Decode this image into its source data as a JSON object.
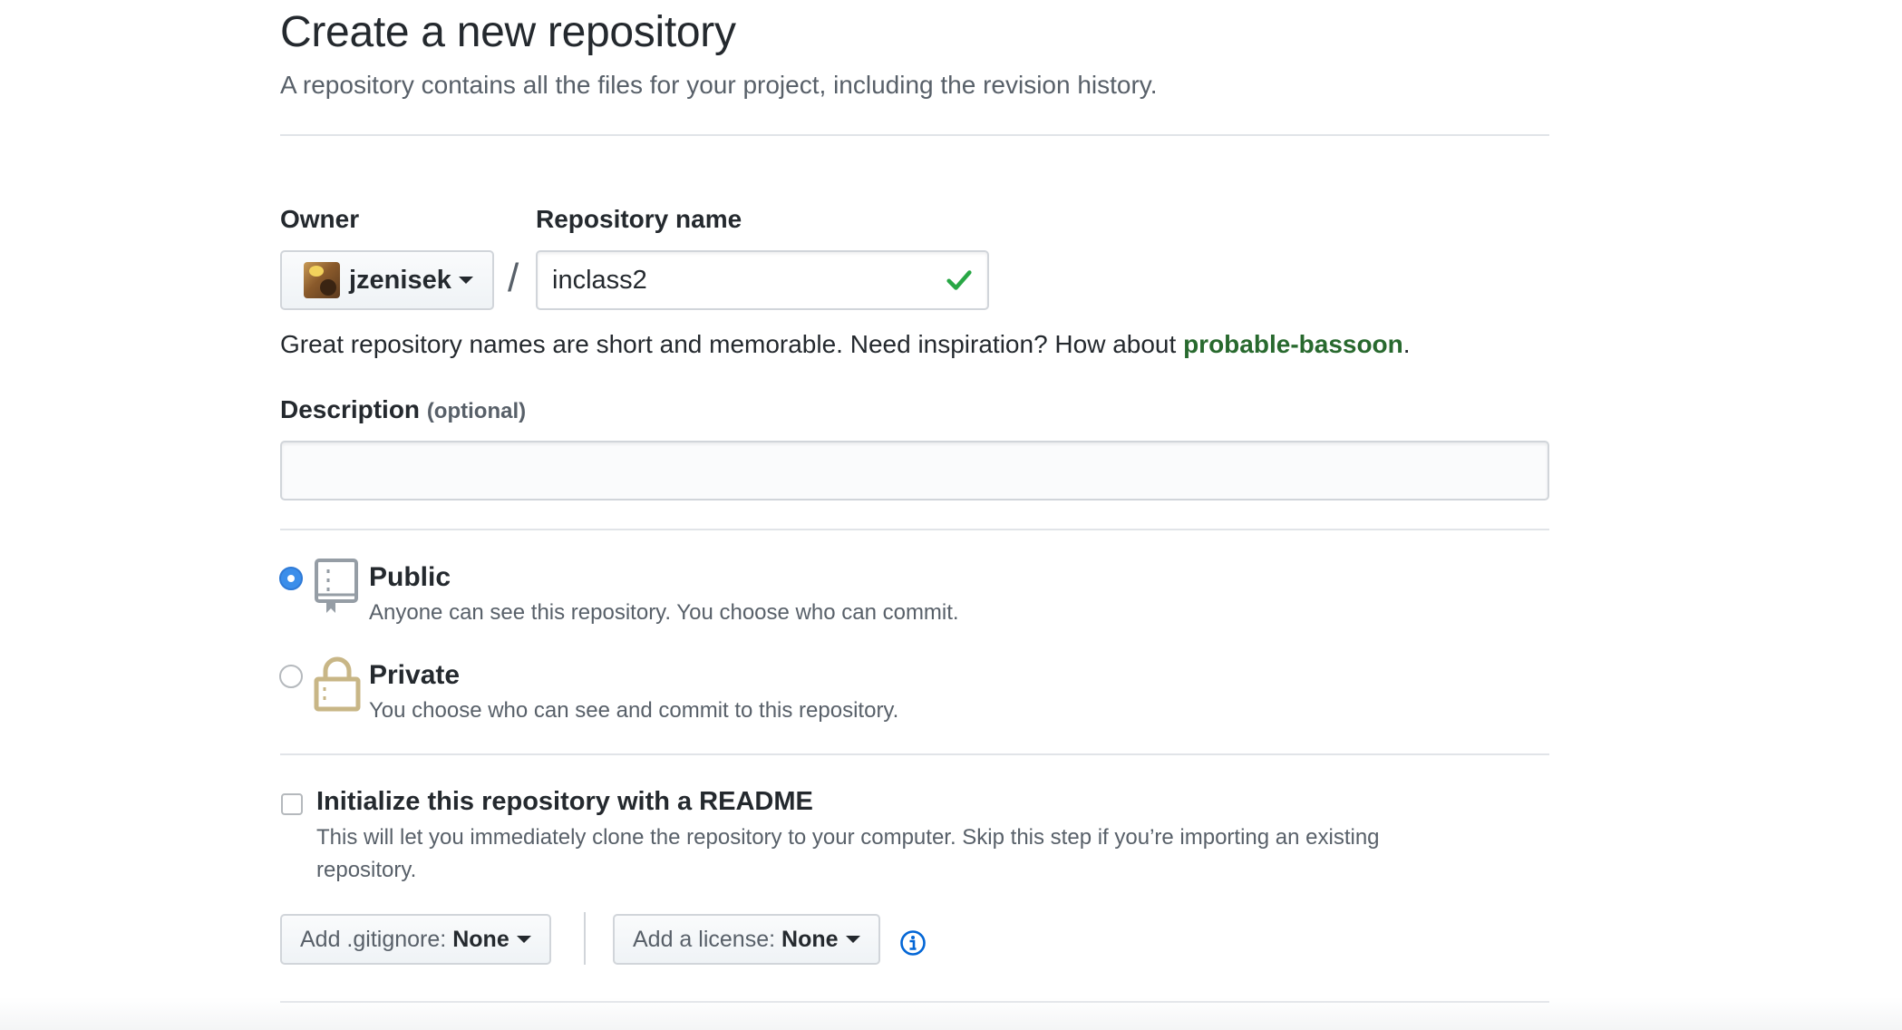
{
  "header": {
    "title": "Create a new repository",
    "subtitle": "A repository contains all the files for your project, including the revision history."
  },
  "owner": {
    "label": "Owner",
    "value": "jzenisek",
    "icon": "avatar"
  },
  "separator": "/",
  "repo_name": {
    "label": "Repository name",
    "value": "inclass2",
    "valid": true,
    "status_icon": "check-icon",
    "status_color": "#28a745"
  },
  "name_hint": {
    "text": "Great repository names are short and memorable. Need inspiration? How about ",
    "suggestion": "probable-bassoon",
    "suffix": "."
  },
  "description": {
    "label": "Description",
    "optional_note": "(optional)",
    "value": ""
  },
  "visibility": {
    "selected": "public",
    "options": [
      {
        "id": "public",
        "label": "Public",
        "desc": "Anyone can see this repository. You choose who can commit.",
        "icon": "repo-book-icon"
      },
      {
        "id": "private",
        "label": "Private",
        "desc": "You choose who can see and commit to this repository.",
        "icon": "lock-icon"
      }
    ]
  },
  "readme": {
    "label": "Initialize this repository with a README",
    "desc_line1": "This will let you immediately clone the repository to your computer. Skip this step if you’re importing an existing",
    "desc_line2": "repository.",
    "checked": false
  },
  "gitignore": {
    "label": "Add .gitignore:",
    "value": "None"
  },
  "license": {
    "label": "Add a license:",
    "value": "None",
    "info_icon": "info-icon"
  },
  "colors": {
    "accent": "#0366d6",
    "success": "#28a745",
    "suggestion": "#28692e",
    "radio_selected": "#3b8eea",
    "lock": "#c8b686"
  }
}
